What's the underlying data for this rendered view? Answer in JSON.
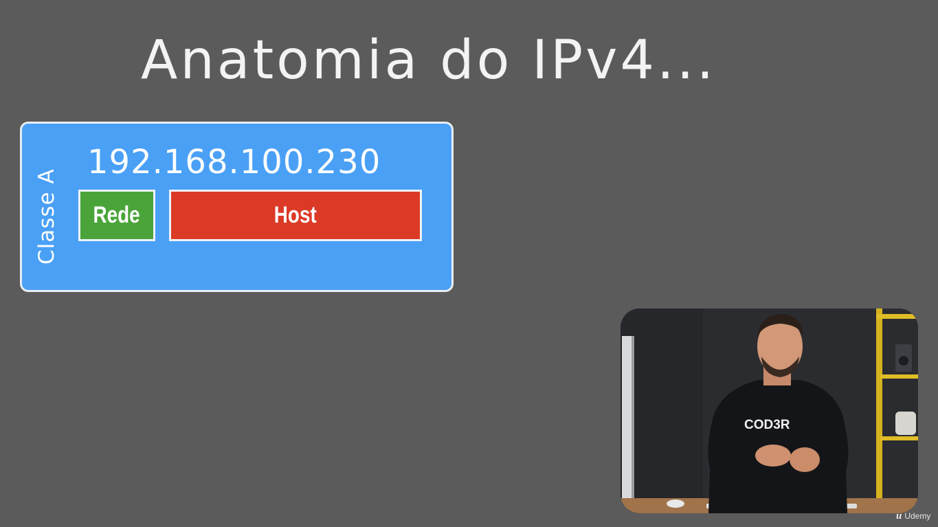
{
  "slide": {
    "title": "Anatomia do IPv4...",
    "card": {
      "class_label": "Classe A",
      "ip_address": "192.168.100.230",
      "network_label": "Rede",
      "host_label": "Host",
      "colors": {
        "card": "#4aa0f5",
        "network": "#4aa43a",
        "host": "#db3a26",
        "border": "#eef2f6"
      }
    }
  },
  "presenter": {
    "shirt_text": "COD3R"
  },
  "watermark": {
    "logo_icon": "udemy-logo-icon",
    "label": "Udemy"
  }
}
